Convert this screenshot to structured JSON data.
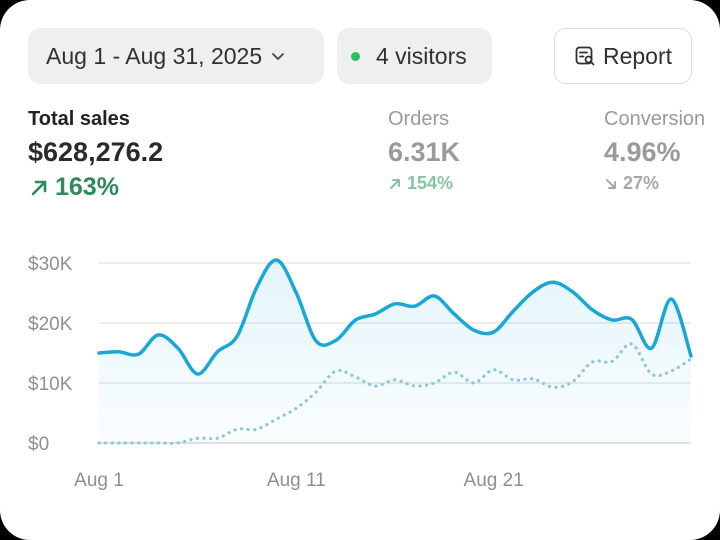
{
  "header": {
    "date_range": "Aug 1 - Aug 31, 2025",
    "visitors": "4 visitors",
    "report_label": "Report"
  },
  "metrics": {
    "total_sales": {
      "label": "Total sales",
      "value": "$628,276.2",
      "change": "163%",
      "direction": "up"
    },
    "orders": {
      "label": "Orders",
      "value": "6.31K",
      "change": "154%",
      "direction": "up"
    },
    "conversion": {
      "label": "Conversion",
      "value": "4.96%",
      "change": "27%",
      "direction": "down"
    }
  },
  "colors": {
    "accent": "#1aa7d8",
    "positive": "#2e8a57",
    "live_dot": "#22c55e",
    "previous_series": "#8fc9dc"
  },
  "icons": [
    "chevron-down-icon",
    "report-icon",
    "arrow-up-right-icon",
    "arrow-down-right-icon"
  ],
  "chart_data": {
    "type": "line",
    "title": "",
    "xlabel": "",
    "ylabel": "",
    "ylim": [
      0,
      30000
    ],
    "y_ticks": [
      0,
      10000,
      20000,
      30000
    ],
    "y_tick_labels": [
      "$0",
      "$10K",
      "$20K",
      "$30K"
    ],
    "x": [
      1,
      2,
      3,
      4,
      5,
      6,
      7,
      8,
      9,
      10,
      11,
      12,
      13,
      14,
      15,
      16,
      17,
      18,
      19,
      20,
      21,
      22,
      23,
      24,
      25,
      26,
      27,
      28,
      29,
      30,
      31
    ],
    "x_tick_labels": [
      {
        "value": 1,
        "label": "Aug 1"
      },
      {
        "value": 11,
        "label": "Aug 11"
      },
      {
        "value": 21,
        "label": "Aug 21"
      }
    ],
    "grid": true,
    "series": [
      {
        "style": "solid-area",
        "values": [
          15000,
          15200,
          14800,
          18000,
          15800,
          11500,
          15200,
          17800,
          26000,
          30500,
          25000,
          17000,
          17100,
          20500,
          21500,
          23200,
          22800,
          24500,
          21500,
          18800,
          18500,
          22000,
          25200,
          26800,
          25200,
          22200,
          20500,
          20600,
          15800,
          24000,
          14500
        ]
      },
      {
        "style": "dotted",
        "values": [
          0,
          0,
          0,
          0,
          0,
          800,
          800,
          2300,
          2300,
          4000,
          5800,
          8500,
          12000,
          11000,
          9500,
          10500,
          9500,
          10000,
          11800,
          10000,
          12200,
          10500,
          10700,
          9300,
          10200,
          13500,
          13600,
          16500,
          11500,
          12000,
          14000
        ]
      }
    ]
  }
}
